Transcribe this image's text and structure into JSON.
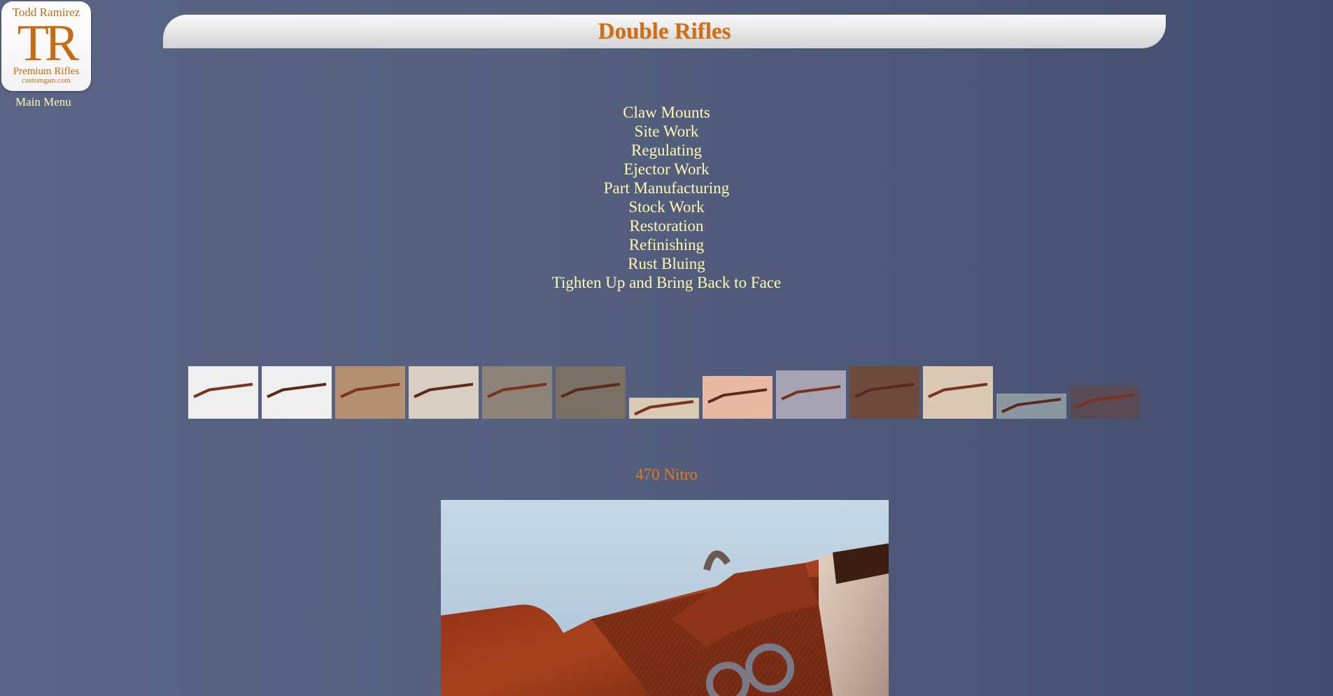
{
  "logo": {
    "top_text": "Todd Ramirez",
    "monogram": "TR",
    "sub_text": "Premium Rifles",
    "url_text": "customgun.com"
  },
  "nav": {
    "main_menu": "Main Menu"
  },
  "page_title": "Double Rifles",
  "menu_links": [
    "Claw Mounts",
    "Site Work",
    "Regulating",
    "Ejector Work",
    "Part Manufacturing",
    "Stock Work",
    "Restoration",
    "Refinishing",
    "Rust Bluing",
    "Tighten Up and Bring Back to Face"
  ],
  "thumbnails": [
    {
      "name": "rifle-white-bg-1",
      "bg": "#efefef",
      "fill": 1.0
    },
    {
      "name": "rifle-white-bg-2",
      "bg": "#efefef",
      "fill": 1.0
    },
    {
      "name": "barrels-pegboard",
      "bg": "#b49070",
      "fill": 1.0
    },
    {
      "name": "barrels-pegboard-closeup",
      "bg": "#d8cfc2",
      "fill": 1.0
    },
    {
      "name": "parts-bench",
      "bg": "#8c8478",
      "fill": 1.0
    },
    {
      "name": "action-pegboard",
      "bg": "#7a7065",
      "fill": 1.0
    },
    {
      "name": "rifle-scope-small",
      "bg": "#d9cbb5",
      "fill": 0.4
    },
    {
      "name": "rifle-pink-bg",
      "bg": "#e9b9a6",
      "fill": 0.82
    },
    {
      "name": "stock-parts-gray",
      "bg": "#a6a3b5",
      "fill": 0.92
    },
    {
      "name": "rifles-standing",
      "bg": "#6e4a3c",
      "fill": 1.0
    },
    {
      "name": "barrels-tan",
      "bg": "#dcc9b5",
      "fill": 1.0
    },
    {
      "name": "rifle-gray-small",
      "bg": "#8a96a0",
      "fill": 0.48
    },
    {
      "name": "rifle-dark-small",
      "bg": "#5a4a54",
      "fill": 0.62
    }
  ],
  "caption": "470 Nitro",
  "colors": {
    "link": "#fff8b0",
    "title": "#d46c10",
    "caption": "#e07b18"
  }
}
